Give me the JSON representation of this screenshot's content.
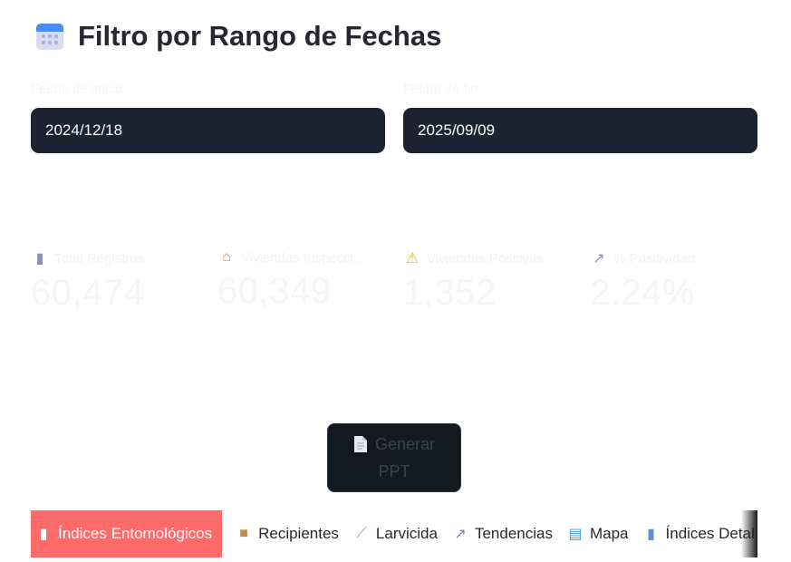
{
  "header": {
    "title": "Filtro por Rango de Fechas",
    "icon": "calendar-icon"
  },
  "filters": {
    "start_label": "Fecha de inicio",
    "start_value": "2024/12/18",
    "end_label": "Fecha de fin",
    "end_value": "2025/09/09"
  },
  "metrics": [
    {
      "icon": "bar-chart-icon",
      "label": "Total Registros",
      "value": "60,474"
    },
    {
      "icon": "house-icon",
      "label": "Viviendas Inspecci...",
      "value": "60,349"
    },
    {
      "icon": "warning-icon",
      "label": "Viviendas Positivas",
      "value": "1,352"
    },
    {
      "icon": "trend-up-icon",
      "label": "% Positividad",
      "value": "2.24%"
    }
  ],
  "actions": {
    "generate_line1": "Generar",
    "generate_line2": "PPT"
  },
  "tabs": [
    {
      "icon": "bar-chart-icon",
      "label": "Índices Entomológicos",
      "active": true
    },
    {
      "icon": "package-icon",
      "label": "Recipientes"
    },
    {
      "icon": "test-tube-icon",
      "label": "Larvicida"
    },
    {
      "icon": "trend-up-icon",
      "label": "Tendencias"
    },
    {
      "icon": "map-icon",
      "label": "Mapa"
    },
    {
      "icon": "bar-chart-icon",
      "label": "Índices Detal"
    }
  ],
  "colors": {
    "accent": "#ff6b6b",
    "input_bg": "#1c2432",
    "button_bg": "#141920"
  }
}
